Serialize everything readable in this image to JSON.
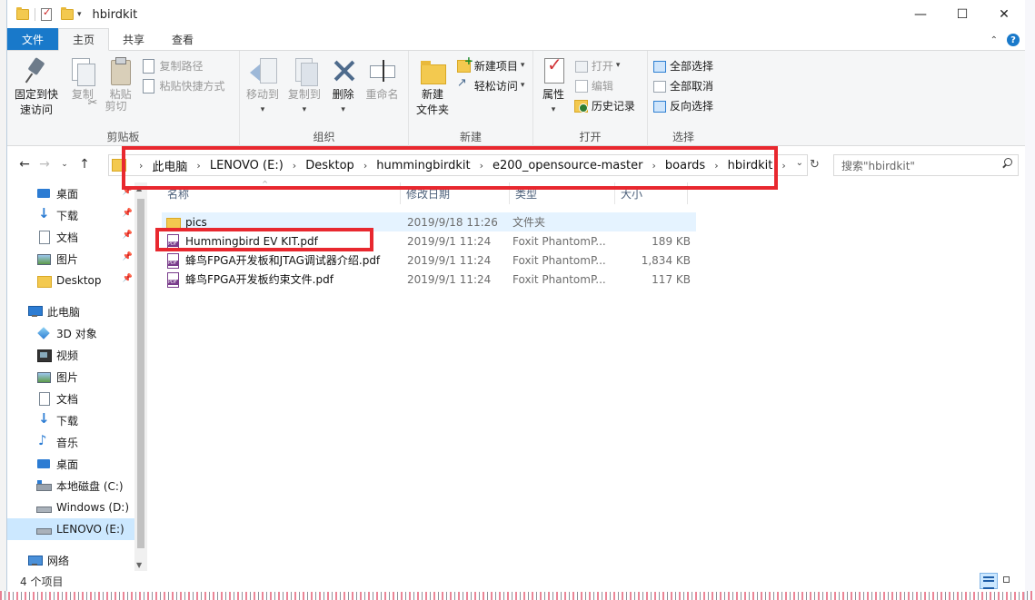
{
  "window": {
    "title": "hbirdkit",
    "controls": {
      "minimize": "—",
      "maximize": "☐",
      "close": "✕"
    }
  },
  "ribbon_tabs": [
    "文件",
    "主页",
    "共享",
    "查看"
  ],
  "ribbon": {
    "clipboard": {
      "label": "剪贴板",
      "pin_quick_access": "固定到快\n速访问",
      "copy": "复制",
      "paste": "粘贴",
      "copy_path": "复制路径",
      "paste_shortcut": "粘贴快捷方式",
      "cut": "剪切"
    },
    "organize": {
      "label": "组织",
      "move_to": "移动到",
      "copy_to": "复制到",
      "delete": "删除",
      "rename": "重命名"
    },
    "new": {
      "label": "新建",
      "new_folder": "新建\n文件夹",
      "new_item": "新建项目",
      "easy_access": "轻松访问"
    },
    "open": {
      "label": "打开",
      "properties": "属性",
      "open": "打开",
      "edit": "编辑",
      "history": "历史记录"
    },
    "select": {
      "label": "选择",
      "select_all": "全部选择",
      "select_none": "全部取消",
      "invert": "反向选择"
    }
  },
  "address": {
    "crumbs": [
      "此电脑",
      "LENOVO (E:)",
      "Desktop",
      "hummingbirdkit",
      "e200_opensource-master",
      "boards",
      "hbirdkit"
    ],
    "search_placeholder": "搜索\"hbirdkit\""
  },
  "nav": {
    "quick_access": [
      {
        "label": "桌面",
        "icon": "desktop-icon",
        "pinned": true
      },
      {
        "label": "下载",
        "icon": "downloads-icon",
        "pinned": true
      },
      {
        "label": "文档",
        "icon": "documents-icon",
        "pinned": true
      },
      {
        "label": "图片",
        "icon": "pictures-icon",
        "pinned": true
      },
      {
        "label": "Desktop",
        "icon": "folder-icon",
        "pinned": true
      }
    ],
    "this_pc": "此电脑",
    "pc_items": [
      {
        "label": "3D 对象",
        "icon": "3d-objects-icon"
      },
      {
        "label": "视频",
        "icon": "videos-icon"
      },
      {
        "label": "图片",
        "icon": "pictures-icon"
      },
      {
        "label": "文档",
        "icon": "documents-icon"
      },
      {
        "label": "下载",
        "icon": "downloads-icon"
      },
      {
        "label": "音乐",
        "icon": "music-icon"
      },
      {
        "label": "桌面",
        "icon": "desktop-icon"
      },
      {
        "label": "本地磁盘 (C:)",
        "icon": "drive-icon"
      },
      {
        "label": "Windows (D:)",
        "icon": "usb-drive-icon"
      },
      {
        "label": "LENOVO (E:)",
        "icon": "usb-drive-icon",
        "selected": true
      }
    ],
    "network": "网络"
  },
  "columns": {
    "name": "名称",
    "date": "修改日期",
    "type": "类型",
    "size": "大小"
  },
  "files": [
    {
      "name": "pics",
      "date": "2019/9/18 11:26",
      "type": "文件夹",
      "size": "",
      "kind": "folder"
    },
    {
      "name": "Hummingbird EV KIT.pdf",
      "date": "2019/9/1 11:24",
      "type": "Foxit PhantomP...",
      "size": "189 KB",
      "kind": "pdf"
    },
    {
      "name": "蜂鸟FPGA开发板和JTAG调试器介绍.pdf",
      "date": "2019/9/1 11:24",
      "type": "Foxit PhantomP...",
      "size": "1,834 KB",
      "kind": "pdf"
    },
    {
      "name": "蜂鸟FPGA开发板约束文件.pdf",
      "date": "2019/9/1 11:24",
      "type": "Foxit PhantomP...",
      "size": "117 KB",
      "kind": "pdf"
    }
  ],
  "status": {
    "count": "4 个项目"
  },
  "highlight_color": "#e8282f"
}
